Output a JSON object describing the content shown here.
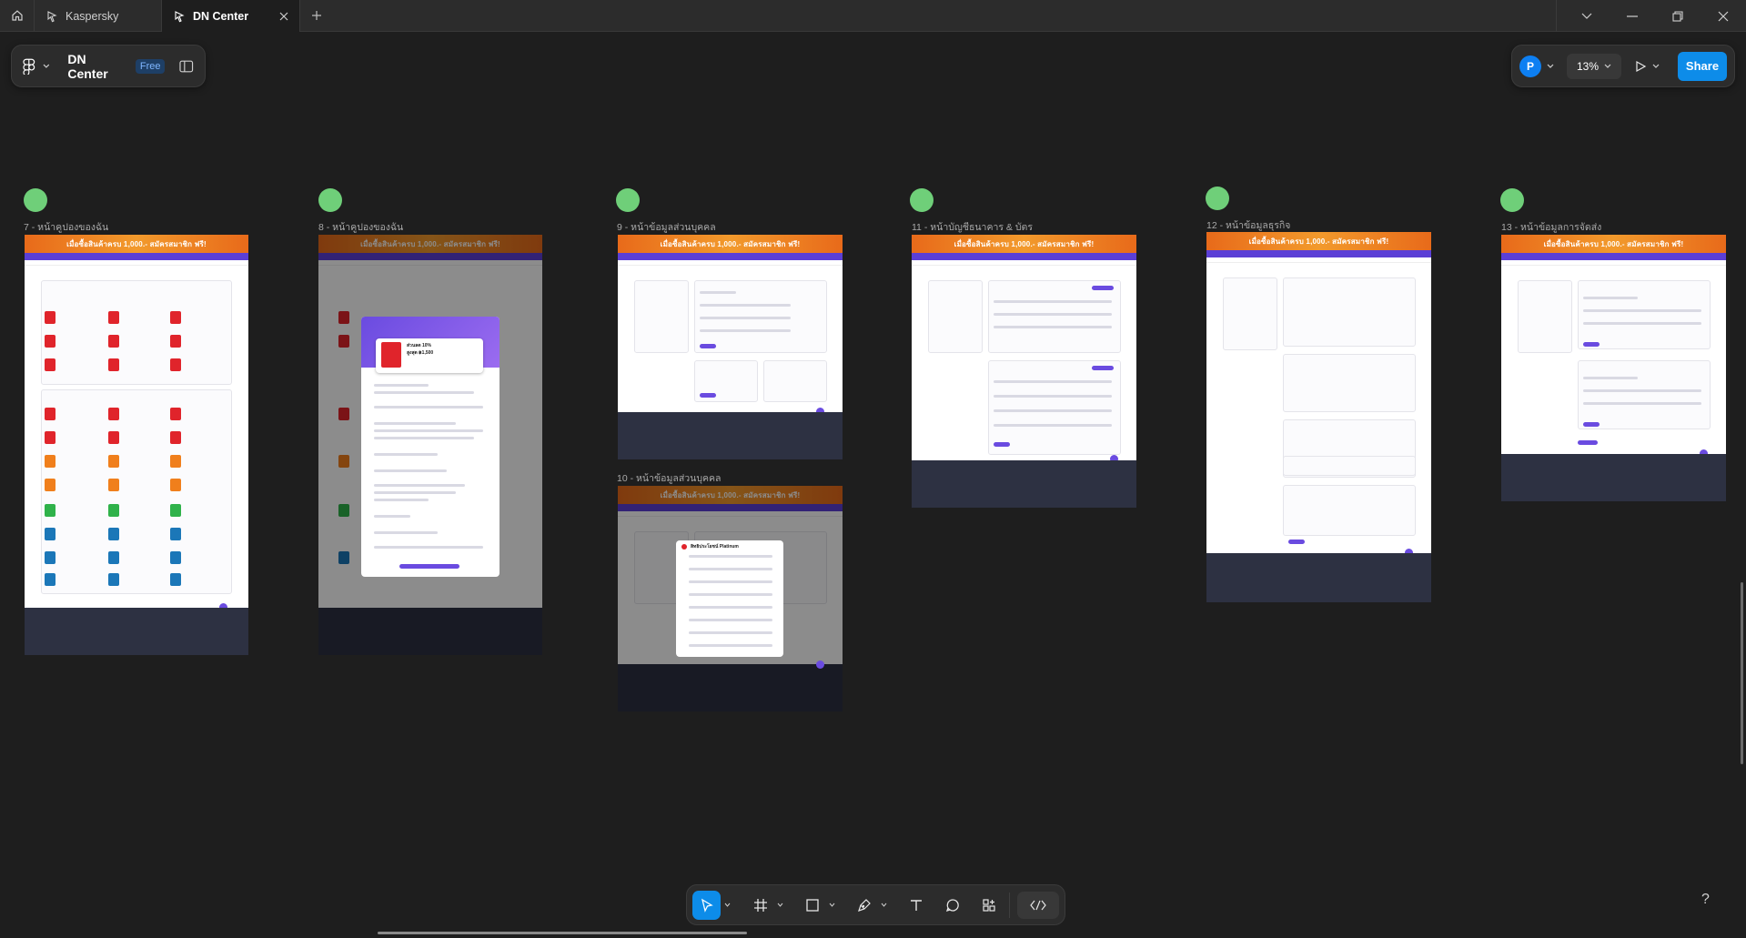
{
  "tabs": [
    {
      "label": "Kaspersky",
      "icon": "figma-file-icon"
    },
    {
      "label": "DN Center",
      "icon": "figma-file-icon",
      "active": true
    }
  ],
  "file": {
    "name": "DN Center",
    "plan_badge": "Free"
  },
  "toolbar_right": {
    "avatar_initial": "P",
    "zoom": "13%",
    "share_label": "Share"
  },
  "frames": [
    {
      "label": "7 - หน้าคูปองของฉัน",
      "banner": "เมื่อซื้อสินค้าครบ 1,000.- สมัครสมาชิก ฟรี!"
    },
    {
      "label": "8 - หน้าคูปองของฉัน",
      "banner": "เมื่อซื้อสินค้าครบ 1,000.- สมัครสมาชิก ฟรี!"
    },
    {
      "label": "9 - หน้าข้อมูลส่วนบุคคล",
      "banner": "เมื่อซื้อสินค้าครบ 1,000.- สมัครสมาชิก ฟรี!"
    },
    {
      "label": "10 - หน้าข้อมูลส่วนบุคคล",
      "banner": "เมื่อซื้อสินค้าครบ 1,000.- สมัครสมาชิก ฟรี!"
    },
    {
      "label": "11 - หน้าบัญชีธนาคาร & บัตร",
      "banner": "เมื่อซื้อสินค้าครบ 1,000.- สมัครสมาชิก ฟรี!"
    },
    {
      "label": "12 - หน้าข้อมูลธุรกิจ",
      "banner": "เมื่อซื้อสินค้าครบ 1,000.- สมัครสมาชิก ฟรี!"
    },
    {
      "label": "13 - หน้าข้อมูลการจัดส่ง",
      "banner": "เมื่อซื้อสินค้าครบ 1,000.- สมัครสมาชิก ฟรี!"
    }
  ],
  "modal_coupon": {
    "title": "ส่วนลด 10%",
    "subtitle": "สูงสุด ฿1,500"
  },
  "modal_platinum": {
    "title": "สิทธิประโยชน์ Platinum"
  },
  "bottom_tools": [
    "move-tool",
    "frame-tool",
    "shape-tool",
    "pen-tool",
    "text-tool",
    "comment-tool",
    "actions-tool",
    "dev-mode-toggle"
  ],
  "help_label": "?",
  "colors": {
    "accent": "#0d8ce9",
    "frame_dot": "#6fcf79",
    "brand_purple": "#5b3fd6",
    "banner_orange": "#e86a1a"
  }
}
